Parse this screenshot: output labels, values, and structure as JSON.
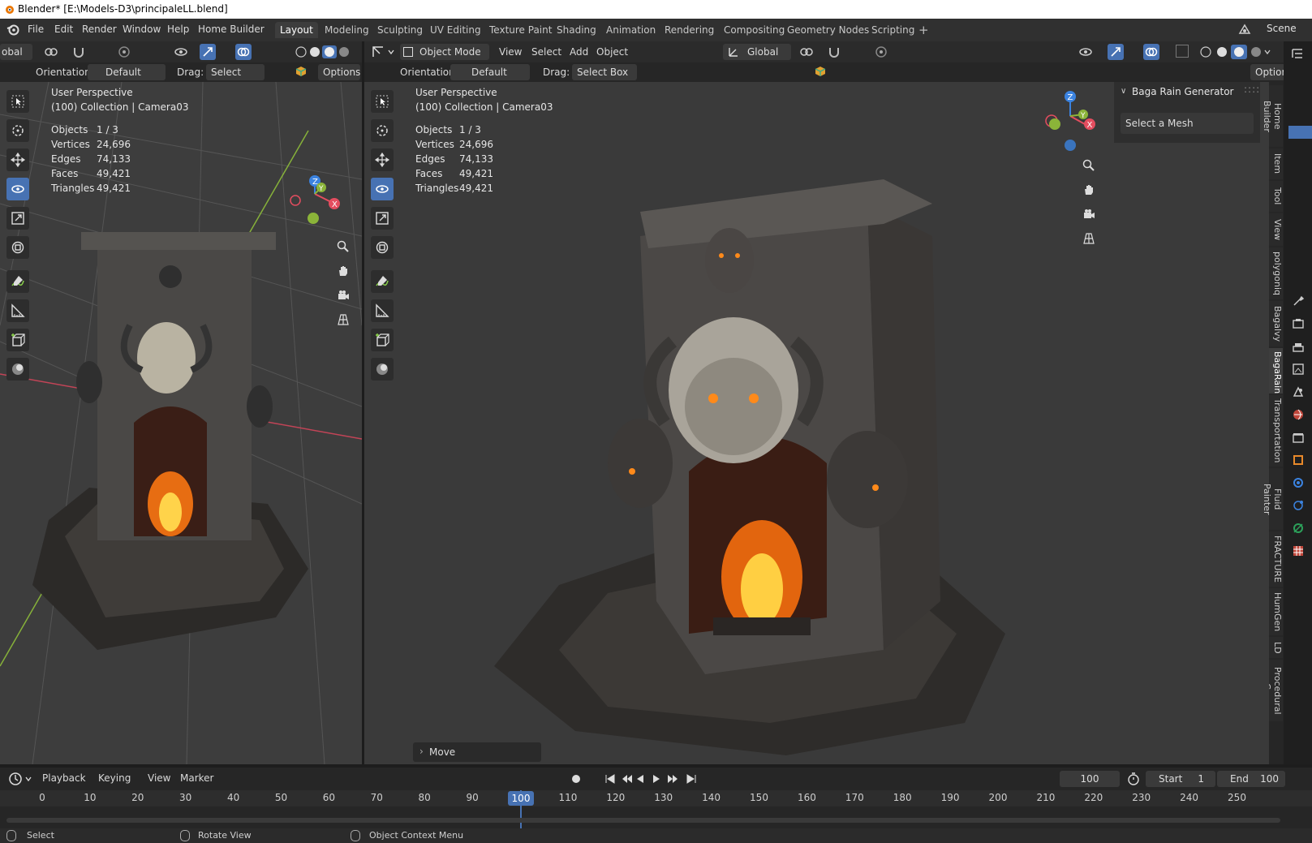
{
  "window": {
    "title": "Blender* [E:\\Models-D3\\principaleLL.blend]"
  },
  "menu": [
    "File",
    "Edit",
    "Render",
    "Window",
    "Help",
    "Home Builder"
  ],
  "workspaces": [
    "Layout",
    "Modeling",
    "Sculpting",
    "UV Editing",
    "Texture Paint",
    "Shading",
    "Animation",
    "Rendering",
    "Compositing",
    "Geometry Nodes",
    "Scripting"
  ],
  "active_workspace": "Layout",
  "scene": {
    "label": "Scene"
  },
  "left_view": {
    "transform_label": "obal",
    "orientation_label": "Orientation:",
    "orientation_value": "Default",
    "drag_label": "Drag:",
    "drag_value": "Select Box",
    "options": "Options",
    "overlay_title": "User Perspective",
    "overlay_sub": "(100) Collection | Camera03",
    "stats": [
      {
        "label": "Objects",
        "value": "1 / 3"
      },
      {
        "label": "Vertices",
        "value": "24,696"
      },
      {
        "label": "Edges",
        "value": "74,133"
      },
      {
        "label": "Faces",
        "value": "49,421"
      },
      {
        "label": "Triangles",
        "value": "49,421"
      }
    ]
  },
  "right_view": {
    "mode": "Object Mode",
    "menus": [
      "View",
      "Select",
      "Add",
      "Object"
    ],
    "transform": "Global",
    "orientation_label": "Orientation:",
    "orientation_value": "Default",
    "drag_label": "Drag:",
    "drag_value": "Select Box",
    "options": "Options",
    "overlay_title": "User Perspective",
    "overlay_sub": "(100) Collection | Camera03",
    "stats": [
      {
        "label": "Objects",
        "value": "1 / 3"
      },
      {
        "label": "Vertices",
        "value": "24,696"
      },
      {
        "label": "Edges",
        "value": "74,133"
      },
      {
        "label": "Faces",
        "value": "49,421"
      },
      {
        "label": "Triangles",
        "value": "49,421"
      }
    ],
    "last_op": "Move",
    "panel_title": "Baga Rain Generator",
    "panel_button": "Select a Mesh",
    "sidebar_tabs": [
      "Home Builder",
      "Item",
      "Tool",
      "View",
      "polygoniq",
      "Bagalvy",
      "BagaRain",
      "Transportation",
      "Fluid Painter",
      "FRACTURE",
      "HumGen",
      "LD",
      "Procedural Cro"
    ],
    "active_tab": "BagaRain"
  },
  "gizmo": {
    "x": "X",
    "y": "Y",
    "z": "Z"
  },
  "timeline": {
    "menus": [
      "Playback",
      "Keying",
      "View",
      "Marker"
    ],
    "current_frame": "100",
    "start_label": "Start",
    "start": "1",
    "end_label": "End",
    "end": "100",
    "ticks": [
      "0",
      "10",
      "20",
      "30",
      "40",
      "50",
      "60",
      "70",
      "80",
      "90",
      "100",
      "110",
      "120",
      "130",
      "140",
      "150",
      "160",
      "170",
      "180",
      "190",
      "200",
      "210",
      "220",
      "230",
      "240",
      "250"
    ]
  },
  "status": {
    "select": "Select",
    "rotate": "Rotate View",
    "context": "Object Context Menu"
  },
  "colors": {
    "accent": "#4772b3",
    "x_axis": "#e44d5f",
    "y_axis": "#8bb439",
    "z_axis": "#3b83e0"
  }
}
